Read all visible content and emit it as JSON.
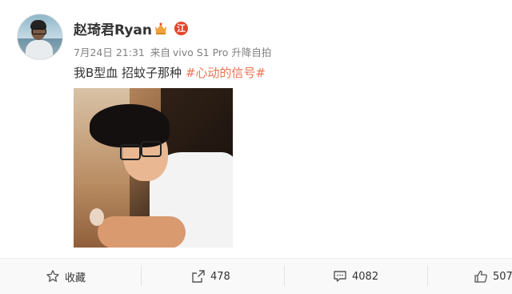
{
  "post": {
    "username": "赵琦君Ryan",
    "level_badge": "江",
    "date": "7月24日 21:31",
    "source_prefix": "来自",
    "source_device": "vivo S1 Pro 升降自拍",
    "text": "我B型血 招蚊子那种",
    "hashtag": "#心动的信号#"
  },
  "actions": {
    "favorite": {
      "label": "收藏",
      "icon": "star-icon"
    },
    "repost": {
      "count": "478",
      "icon": "share-icon"
    },
    "comment": {
      "count": "4082",
      "icon": "comment-icon"
    },
    "like": {
      "count": "507",
      "icon": "thumbs-up-icon"
    }
  },
  "colors": {
    "hashtag": "#eb7350",
    "meta_text": "#808080",
    "badge_red": "#e2462c",
    "badge_gold": "#f0a23a"
  }
}
